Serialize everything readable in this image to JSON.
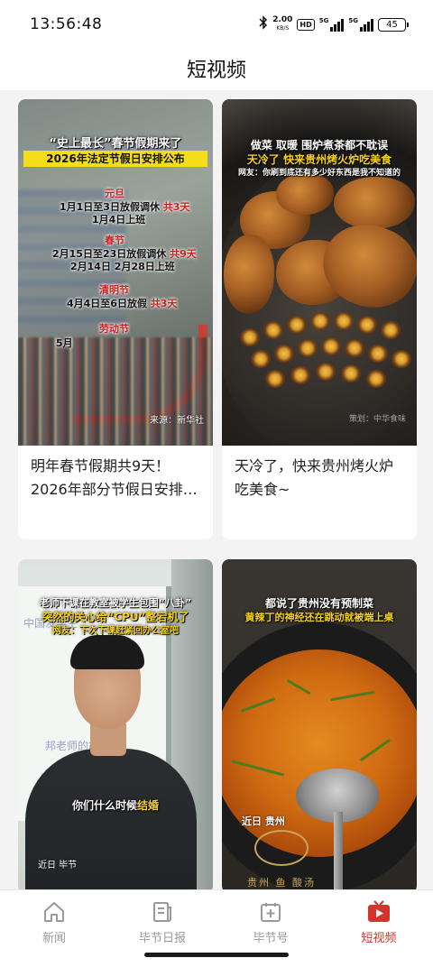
{
  "status_bar": {
    "time": "13:56:48",
    "speed_value": "2.00",
    "speed_unit": "KB/S",
    "hd_label": "HD",
    "signal1_label": "5G",
    "signal2_label": "5G",
    "battery": "45"
  },
  "header": {
    "title": "短视频"
  },
  "videos": [
    {
      "caption": "明年春节假期共9天！2026年部分节假日安排…",
      "overlay": {
        "headline1": "“史上最长”春节假期来了",
        "headline2": "2026年法定节假日安排公布",
        "yuandan": "元旦",
        "yuandan_detail": "1月1日至3日放假调休",
        "yuandan_days": "共3天",
        "yuandan_work": "1月4日上班",
        "chunjie": "春节",
        "chunjie_detail": "2月15日至23日放假调休",
        "chunjie_days": "共9天",
        "chunjie_work": "2月14日 2月28日上班",
        "qingming": "清明节",
        "qingming_detail": "4月4日至6日放假",
        "qingming_days": "共3天",
        "laodong": "劳动节",
        "laodong_month": "5月",
        "source": "来源：新华社"
      }
    },
    {
      "caption": "天冷了，快来贵州烤火炉吃美食~",
      "overlay": {
        "line1": "做菜 取暖 围炉煮茶都不耽误",
        "line2": "天冷了 快来贵州烤火炉吃美食",
        "line3": "网友：你刷到底还有多少好东西是我不知道的",
        "watermark": "策划：中华食味"
      }
    },
    {
      "caption": "",
      "overlay": {
        "line1": "老师下课在教室被学生包围“八卦”",
        "line2": "突然的关心给“CPU”整宕机了",
        "line3": "网友：下次下课赶紧回办公室吧",
        "subtitle_prefix": "你们什么时候",
        "subtitle_highlight": "结婚",
        "location": "近日 毕节",
        "board_text1": "中国发学生",
        "board_text2": "邦老师的故事"
      }
    },
    {
      "caption": "",
      "overlay": {
        "line1": "都说了贵州没有预制菜",
        "line2": "黄辣丁的神经还在跳动就被端上桌",
        "location": "近日 贵州",
        "rim_text": "贵州 鱼 酸汤"
      }
    }
  ],
  "bottom_nav": [
    {
      "label": "新闻",
      "icon": "home-icon",
      "active": false
    },
    {
      "label": "毕节日报",
      "icon": "newspaper-icon",
      "active": false
    },
    {
      "label": "毕节号",
      "icon": "add-box-icon",
      "active": false
    },
    {
      "label": "短视频",
      "icon": "video-play-icon",
      "active": true
    }
  ],
  "colors": {
    "accent": "#d4342b",
    "inactive": "#999999",
    "caption_yellow": "#f6d21c"
  }
}
